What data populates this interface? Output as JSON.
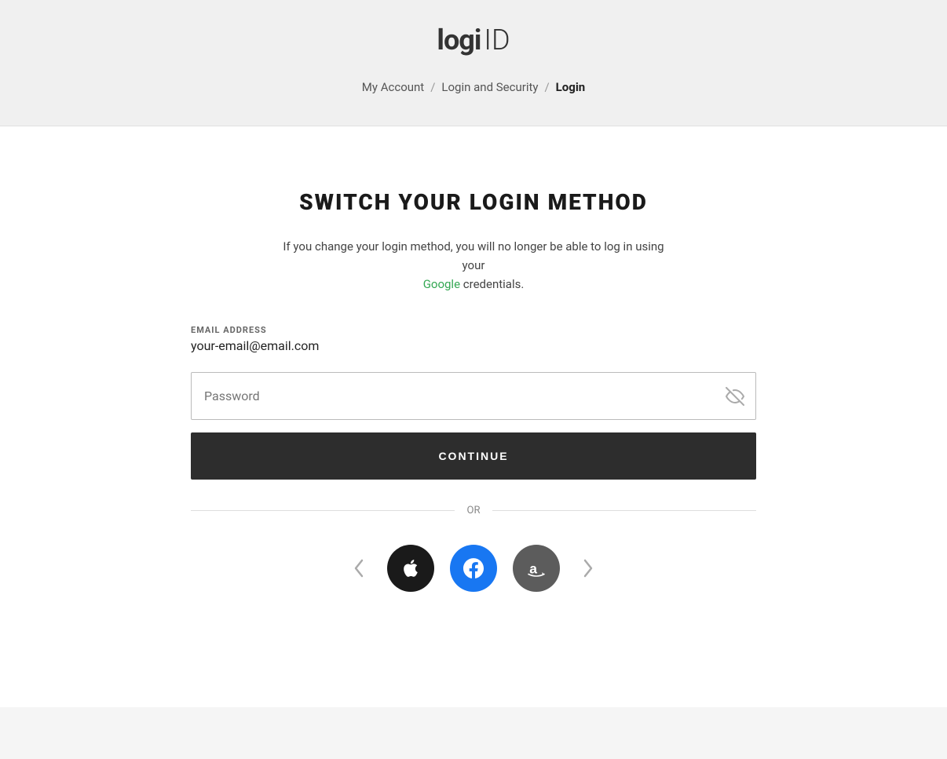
{
  "header": {
    "logo_logi": "logi",
    "logo_id": "ID",
    "breadcrumb": {
      "my_account": "My Account",
      "separator1": "/",
      "login_security": "Login and Security",
      "separator2": "/",
      "current": "Login"
    }
  },
  "main": {
    "title": "SWITCH YOUR LOGIN METHOD",
    "description_part1": "If you change your login method, you will no longer be able to log in using your",
    "google_text": "Google",
    "description_part2": "credentials.",
    "email_label": "EMAIL ADDRESS",
    "email_value": "your-email@email.com",
    "password_placeholder": "Password",
    "continue_label": "CONTINUE",
    "or_text": "OR",
    "social_buttons": [
      {
        "id": "apple",
        "label": "Apple"
      },
      {
        "id": "facebook",
        "label": "Facebook"
      },
      {
        "id": "amazon",
        "label": "Amazon"
      }
    ]
  },
  "icons": {
    "eye_hidden": "👁",
    "arrow_left": "‹",
    "arrow_right": "›",
    "apple_symbol": "",
    "facebook_symbol": "f",
    "amazon_symbol": "a"
  },
  "colors": {
    "accent_green": "#34a853",
    "button_dark": "#2d2d2d",
    "facebook_blue": "#1877f2",
    "amazon_gray": "#5c5c5c",
    "apple_black": "#1a1a1a"
  }
}
